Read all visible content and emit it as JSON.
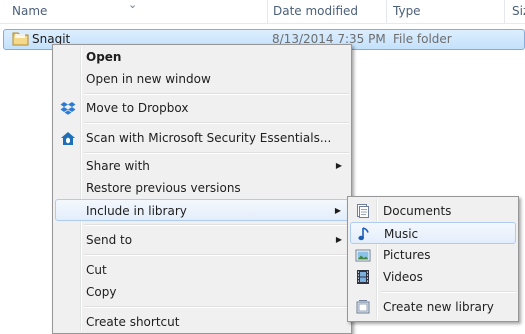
{
  "columns": {
    "name": "Name",
    "date_modified": "Date modified",
    "type": "Type",
    "size": "Siz"
  },
  "file": {
    "name": "Snagit",
    "date": "8/13/2014 7:35 PM",
    "type": "File folder"
  },
  "context_menu": {
    "open": "Open",
    "open_new_window": "Open in new window",
    "move_dropbox": "Move to Dropbox",
    "scan_mse": "Scan with Microsoft Security Essentials...",
    "share_with": "Share with",
    "restore_prev": "Restore previous versions",
    "include_library": "Include in library",
    "send_to": "Send to",
    "cut": "Cut",
    "copy": "Copy",
    "create_shortcut": "Create shortcut"
  },
  "library_submenu": {
    "documents": "Documents",
    "music": "Music",
    "pictures": "Pictures",
    "videos": "Videos",
    "create_new": "Create new library"
  },
  "colors": {
    "selection": "#c4e1fb",
    "menu_bg": "#f0f0f0",
    "highlight_border": "#aeccf0"
  }
}
